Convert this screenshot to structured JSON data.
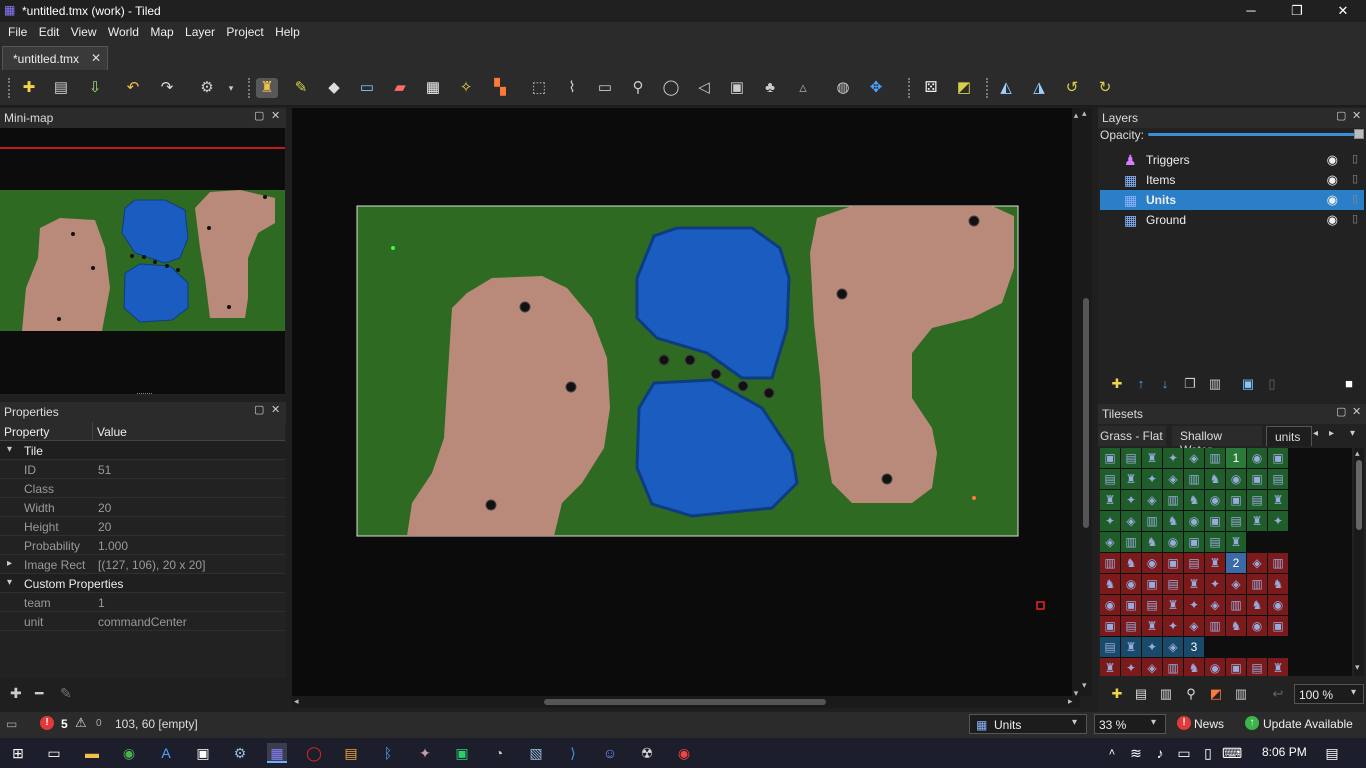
{
  "window": {
    "title": "*untitled.tmx (work) - Tiled",
    "minimize": "─",
    "restore": "❐",
    "close": "✕"
  },
  "menu": [
    "File",
    "Edit",
    "View",
    "World",
    "Map",
    "Layer",
    "Project",
    "Help"
  ],
  "doc_tab": {
    "label": "*untitled.tmx",
    "close": "✕"
  },
  "toolbar": {
    "icons": [
      "new-map-icon",
      "open-icon",
      "export-icon",
      "undo-icon",
      "redo-icon",
      "commands-icon",
      "stamp-brush-icon",
      "terrain-brush-icon",
      "bucket-fill-icon",
      "shape-fill-icon",
      "eraser-icon",
      "rect-select-icon",
      "magic-wand-icon",
      "select-same-tile-icon",
      "select-objects-icon",
      "edit-polygons-icon",
      "insert-rectangle-icon",
      "insert-point-icon",
      "insert-ellipse-icon",
      "insert-polygon-icon",
      "insert-tile-icon",
      "insert-template-icon",
      "insert-text-icon",
      "world-tool-icon",
      "move-icon",
      "random-mode-icon",
      "wang-fill-icon",
      "flip-horizontal-icon",
      "flip-vertical-icon",
      "rotate-left-icon",
      "rotate-right-icon"
    ]
  },
  "minimap": {
    "title": "Mini-map"
  },
  "properties": {
    "title": "Properties",
    "col_property": "Property",
    "col_value": "Value",
    "rows": [
      {
        "kind": "group",
        "key": "Tile",
        "tri": "▾"
      },
      {
        "kind": "item",
        "key": "ID",
        "value": "51"
      },
      {
        "kind": "item",
        "key": "Class",
        "value": ""
      },
      {
        "kind": "item",
        "key": "Width",
        "value": "20"
      },
      {
        "kind": "item",
        "key": "Height",
        "value": "20"
      },
      {
        "kind": "item",
        "key": "Probability",
        "value": "1.000"
      },
      {
        "kind": "item",
        "key": "Image Rect",
        "value": "[(127, 106), 20 x 20]",
        "tri": "▸"
      },
      {
        "kind": "group",
        "key": "Custom Properties",
        "tri": "▾"
      },
      {
        "kind": "item",
        "key": "team",
        "value": "1"
      },
      {
        "kind": "item",
        "key": "unit",
        "value": "commandCenter"
      }
    ]
  },
  "layers": {
    "title": "Layers",
    "opacity_label": "Opacity:",
    "opacity": 1.0,
    "items": [
      {
        "name": "Triggers",
        "icon": "object-layer-icon",
        "selected": false
      },
      {
        "name": "Items",
        "icon": "tile-layer-icon",
        "selected": false
      },
      {
        "name": "Units",
        "icon": "tile-layer-icon",
        "selected": true
      },
      {
        "name": "Ground",
        "icon": "tile-layer-icon",
        "selected": false
      }
    ]
  },
  "tilesets": {
    "title": "Tilesets",
    "tabs": [
      "Grass - Flat",
      "Shallow Water",
      "units"
    ],
    "active_tab": "units",
    "zoom": "100 %",
    "tile_labels": {
      "t1": "1",
      "t2": "2",
      "t3": "3"
    }
  },
  "status": {
    "errors": "5",
    "warnings": "0",
    "coords": "103, 60 [empty]",
    "layer_select": "Units",
    "zoom": "33 %",
    "news": "News",
    "update": "Update Available"
  },
  "taskbar": {
    "time": "8:06 PM"
  },
  "colors": {
    "grass": "#2f6a22",
    "dirt": "#b98a7a",
    "water": "#1a5cc0",
    "selection": "#2a7fc8",
    "accent": "#3a8fd8"
  }
}
